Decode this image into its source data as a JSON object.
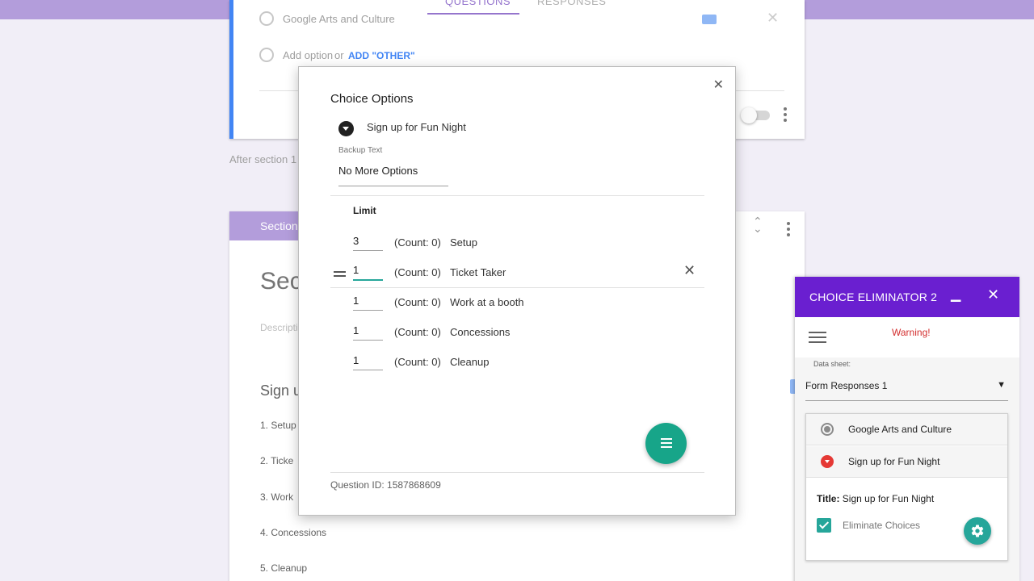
{
  "form": {
    "tabs": [
      "QUESTIONS",
      "RESPONSES"
    ],
    "option_text": "Google Arts and Culture",
    "add_option": "Add option",
    "or_text": "or",
    "add_other": "ADD \"OTHER\"",
    "after_section": "After section 1",
    "section_tab": "Section",
    "section_title": "Sec",
    "section_desc": "Descripti",
    "question_title": "Sign u",
    "list_items": [
      "1.   Setup",
      "2.   Ticke",
      "3.   Work",
      "4.   Concessions",
      "5.   Cleanup"
    ]
  },
  "dialog": {
    "title": "Choice Options",
    "question": "Sign up for Fun Night",
    "backup_label": "Backup Text",
    "backup_value": "No More Options",
    "limit_header": "Limit",
    "rows": [
      {
        "limit": "3",
        "count": "(Count: 0)",
        "name": "Setup"
      },
      {
        "limit": "1",
        "count": "(Count: 0)",
        "name": "Ticket Taker"
      },
      {
        "limit": "1",
        "count": "(Count: 0)",
        "name": "Work at a booth"
      },
      {
        "limit": "1",
        "count": "(Count: 0)",
        "name": "Concessions"
      },
      {
        "limit": "1",
        "count": "(Count: 0)",
        "name": "Cleanup"
      }
    ],
    "question_id": "Question ID: 1587868609"
  },
  "panel": {
    "title": "CHOICE ELIMINATOR 2",
    "warning": "Warning!",
    "data_sheet_label": "Data sheet:",
    "data_sheet_value": "Form Responses 1",
    "questions": [
      "Google Arts and Culture",
      "Sign up for Fun Night"
    ],
    "detail_title_label": "Title:",
    "detail_title_value": "Sign up for Fun Night",
    "eliminate_label": "Eliminate Choices"
  },
  "colors": {
    "form_purple": "#b39ddb",
    "panel_header": "#6a1fd0",
    "teal": "#26a69a",
    "warning_red": "#d32f2f"
  }
}
